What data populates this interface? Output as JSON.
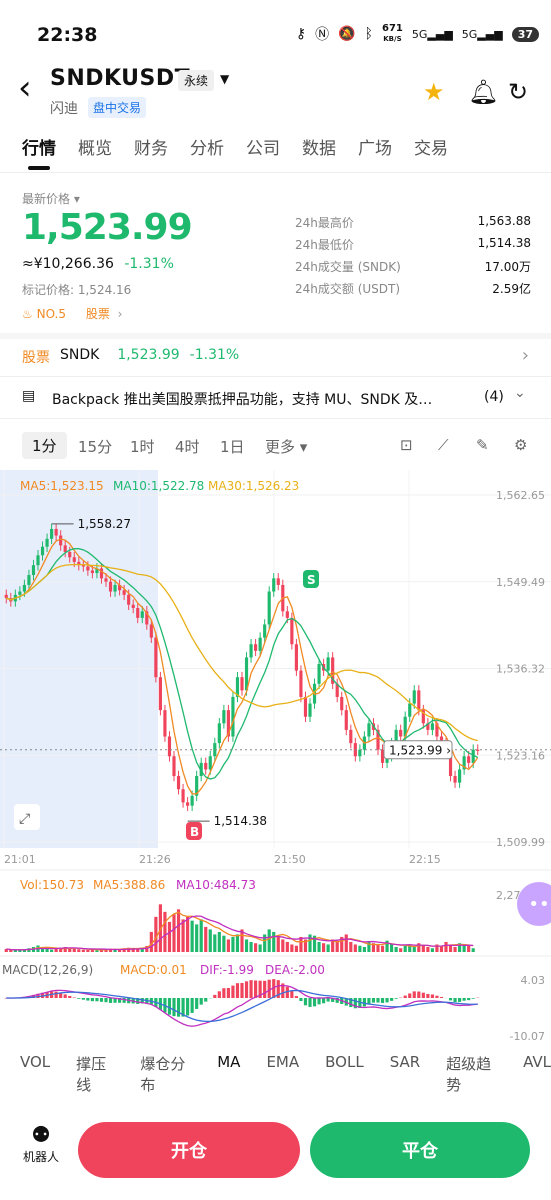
{
  "status": {
    "time": "22:38",
    "net_speed": "671",
    "net_unit": "KB/S",
    "battery": "37"
  },
  "header": {
    "back": "‹",
    "symbol": "SNDKUSDT",
    "contract_tag": "永续",
    "name": "闪迪",
    "session_tag": "盘中交易"
  },
  "tabs": [
    "行情",
    "概览",
    "财务",
    "分析",
    "公司",
    "数据",
    "广场",
    "交易"
  ],
  "price": {
    "label": "最新价格",
    "last": "1,523.99",
    "cny": "≈¥10,266.36",
    "change_pct": "-1.31%",
    "mark_label": "标记价格: 1,524.16",
    "rank": "NO.5",
    "rank_cat": "股票"
  },
  "stats": [
    {
      "k": "24h最高价",
      "v": "1,563.88"
    },
    {
      "k": "24h最低价",
      "v": "1,514.38"
    },
    {
      "k": "24h成交量 (SNDK)",
      "v": "17.00万"
    },
    {
      "k": "24h成交额 (USDT)",
      "v": "2.59亿"
    }
  ],
  "stock_row": {
    "label": "股票",
    "symbol": "SNDK",
    "price": "1,523.99",
    "pct": "-1.31%"
  },
  "news": {
    "text": "Backpack 推出美国股票抵押品功能，支持 MU、SNDK 及…",
    "count": "(4)"
  },
  "timeframes": [
    "1分",
    "15分",
    "1时",
    "4时",
    "1日",
    "更多"
  ],
  "ma_legend": {
    "ma5": "MA5:1,523.15",
    "ma10": "MA10:1,522.78",
    "ma30": "MA30:1,526.23"
  },
  "colors": {
    "up": "#1fb96e",
    "down": "#f0445c",
    "ma5": "#f08a24",
    "ma10": "#1fb96e",
    "ma30": "#e8b017",
    "vol_ma10": "#c02fc0"
  },
  "chart_data": {
    "type": "candlestick",
    "x_ticks": [
      "21:01",
      "21:26",
      "21:50",
      "22:15"
    ],
    "y_ticks": [
      "1,562.65",
      "1,549.49",
      "1,536.32",
      "1,523.16",
      "1,509.99"
    ],
    "ylim": [
      1509.99,
      1562.65
    ],
    "high_label": "1,558.27",
    "low_label": "1,514.38",
    "current_label": "1,523.99",
    "markers": {
      "buy": "B",
      "sell": "S"
    },
    "close": [
      1547,
      1546.5,
      1547.5,
      1548,
      1549,
      1550.5,
      1552,
      1553.5,
      1554.8,
      1556,
      1557.5,
      1556.5,
      1555,
      1554,
      1553.2,
      1552.5,
      1552,
      1551.8,
      1551.2,
      1550.8,
      1551.5,
      1550,
      1549.5,
      1548,
      1549,
      1548.2,
      1547.5,
      1546,
      1545.5,
      1544,
      1545,
      1543,
      1541,
      1535,
      1530,
      1526,
      1523,
      1520,
      1518,
      1516,
      1515.5,
      1517,
      1520,
      1522,
      1521,
      1523,
      1525,
      1528,
      1530,
      1526,
      1532,
      1535,
      1533,
      1538,
      1540,
      1539,
      1541,
      1543,
      1548,
      1550,
      1549,
      1545,
      1544,
      1540,
      1536,
      1532,
      1529,
      1531,
      1534,
      1537,
      1536,
      1538,
      1534,
      1532,
      1530,
      1527,
      1525,
      1523,
      1524,
      1526,
      1528,
      1527,
      1524,
      1522,
      1523,
      1525,
      1527,
      1526,
      1529,
      1531,
      1533,
      1530,
      1528,
      1527,
      1528,
      1526,
      1525,
      1524,
      1520,
      1519,
      1521,
      1523,
      1522,
      1524,
      1523.99
    ],
    "ma5_vol_label": "Vol:150.73",
    "ma5_label": "MA5:388.86",
    "ma10_label": "MA10:484.73",
    "vol_axis_top": "2,271.60",
    "volume": [
      120,
      80,
      60,
      90,
      110,
      150,
      200,
      260,
      180,
      140,
      90,
      120,
      160,
      200,
      150,
      130,
      110,
      90,
      80,
      100,
      70,
      90,
      110,
      130,
      120,
      100,
      150,
      170,
      140,
      130,
      180,
      240,
      800,
      1400,
      1900,
      1600,
      1200,
      1500,
      1700,
      1300,
      1400,
      1250,
      1100,
      1300,
      1000,
      900,
      700,
      800,
      650,
      500,
      600,
      700,
      900,
      500,
      400,
      350,
      300,
      700,
      900,
      800,
      600,
      500,
      400,
      300,
      250,
      600,
      500,
      700,
      650,
      400,
      350,
      300,
      500,
      450,
      600,
      700,
      400,
      300,
      250,
      200,
      400,
      350,
      300,
      250,
      450,
      300,
      200,
      150,
      250,
      300,
      200,
      350,
      250,
      200,
      150,
      300,
      250,
      400,
      300,
      200,
      350,
      250,
      300,
      150
    ],
    "macd_legend": {
      "name": "MACD(12,26,9)",
      "macd": "MACD:0.01",
      "dif": "DIF:-1.99",
      "dea": "DEA:-2.00"
    },
    "macd_axis": [
      "4.03",
      "-10.07"
    ]
  },
  "indicators": [
    "VOL",
    "撑压线",
    "爆仓分布",
    "MA",
    "EMA",
    "BOLL",
    "SAR",
    "超级趋势",
    "AVL"
  ],
  "bottom": {
    "robot": "机器人",
    "open": "开仓",
    "close": "平仓"
  }
}
